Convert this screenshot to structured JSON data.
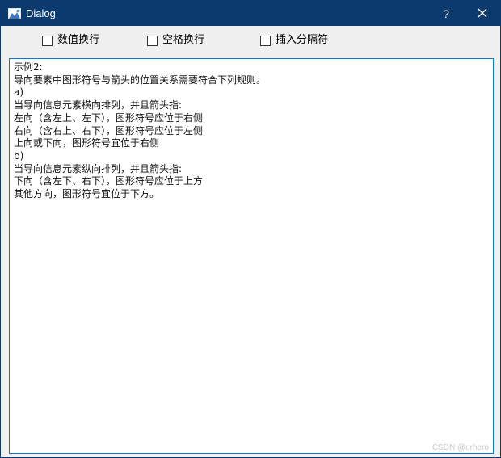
{
  "window": {
    "title": "Dialog",
    "help_label": "?"
  },
  "options": [
    {
      "label": "数值换行",
      "checked": false
    },
    {
      "label": "空格换行",
      "checked": false
    },
    {
      "label": "插入分隔符",
      "checked": false
    }
  ],
  "editor": {
    "lines": [
      "示例2:",
      "导向要素中图形符号与箭头的位置关系需要符合下列规则。",
      "a)",
      "当导向信息元素横向排列，并且箭头指:",
      "左向（含左上、左下），图形符号应位于右侧",
      "右向（含右上、右下），图形符号应位于左侧",
      "上向或下向，图形符号宜位于右侧",
      "b)",
      "当导向信息元素纵向排列，并且箭头指:",
      "下向（含左下、右下），图形符号应位于上方",
      "其他方向，图形符号宜位于下方。"
    ]
  },
  "watermark": "CSDN @urhero",
  "colors": {
    "titlebar": "#0b3a6e",
    "focus_border": "#0a78d7",
    "dialog_background": "#f0f0f0"
  },
  "icons": {
    "app": "image-icon",
    "close": "close-icon"
  }
}
